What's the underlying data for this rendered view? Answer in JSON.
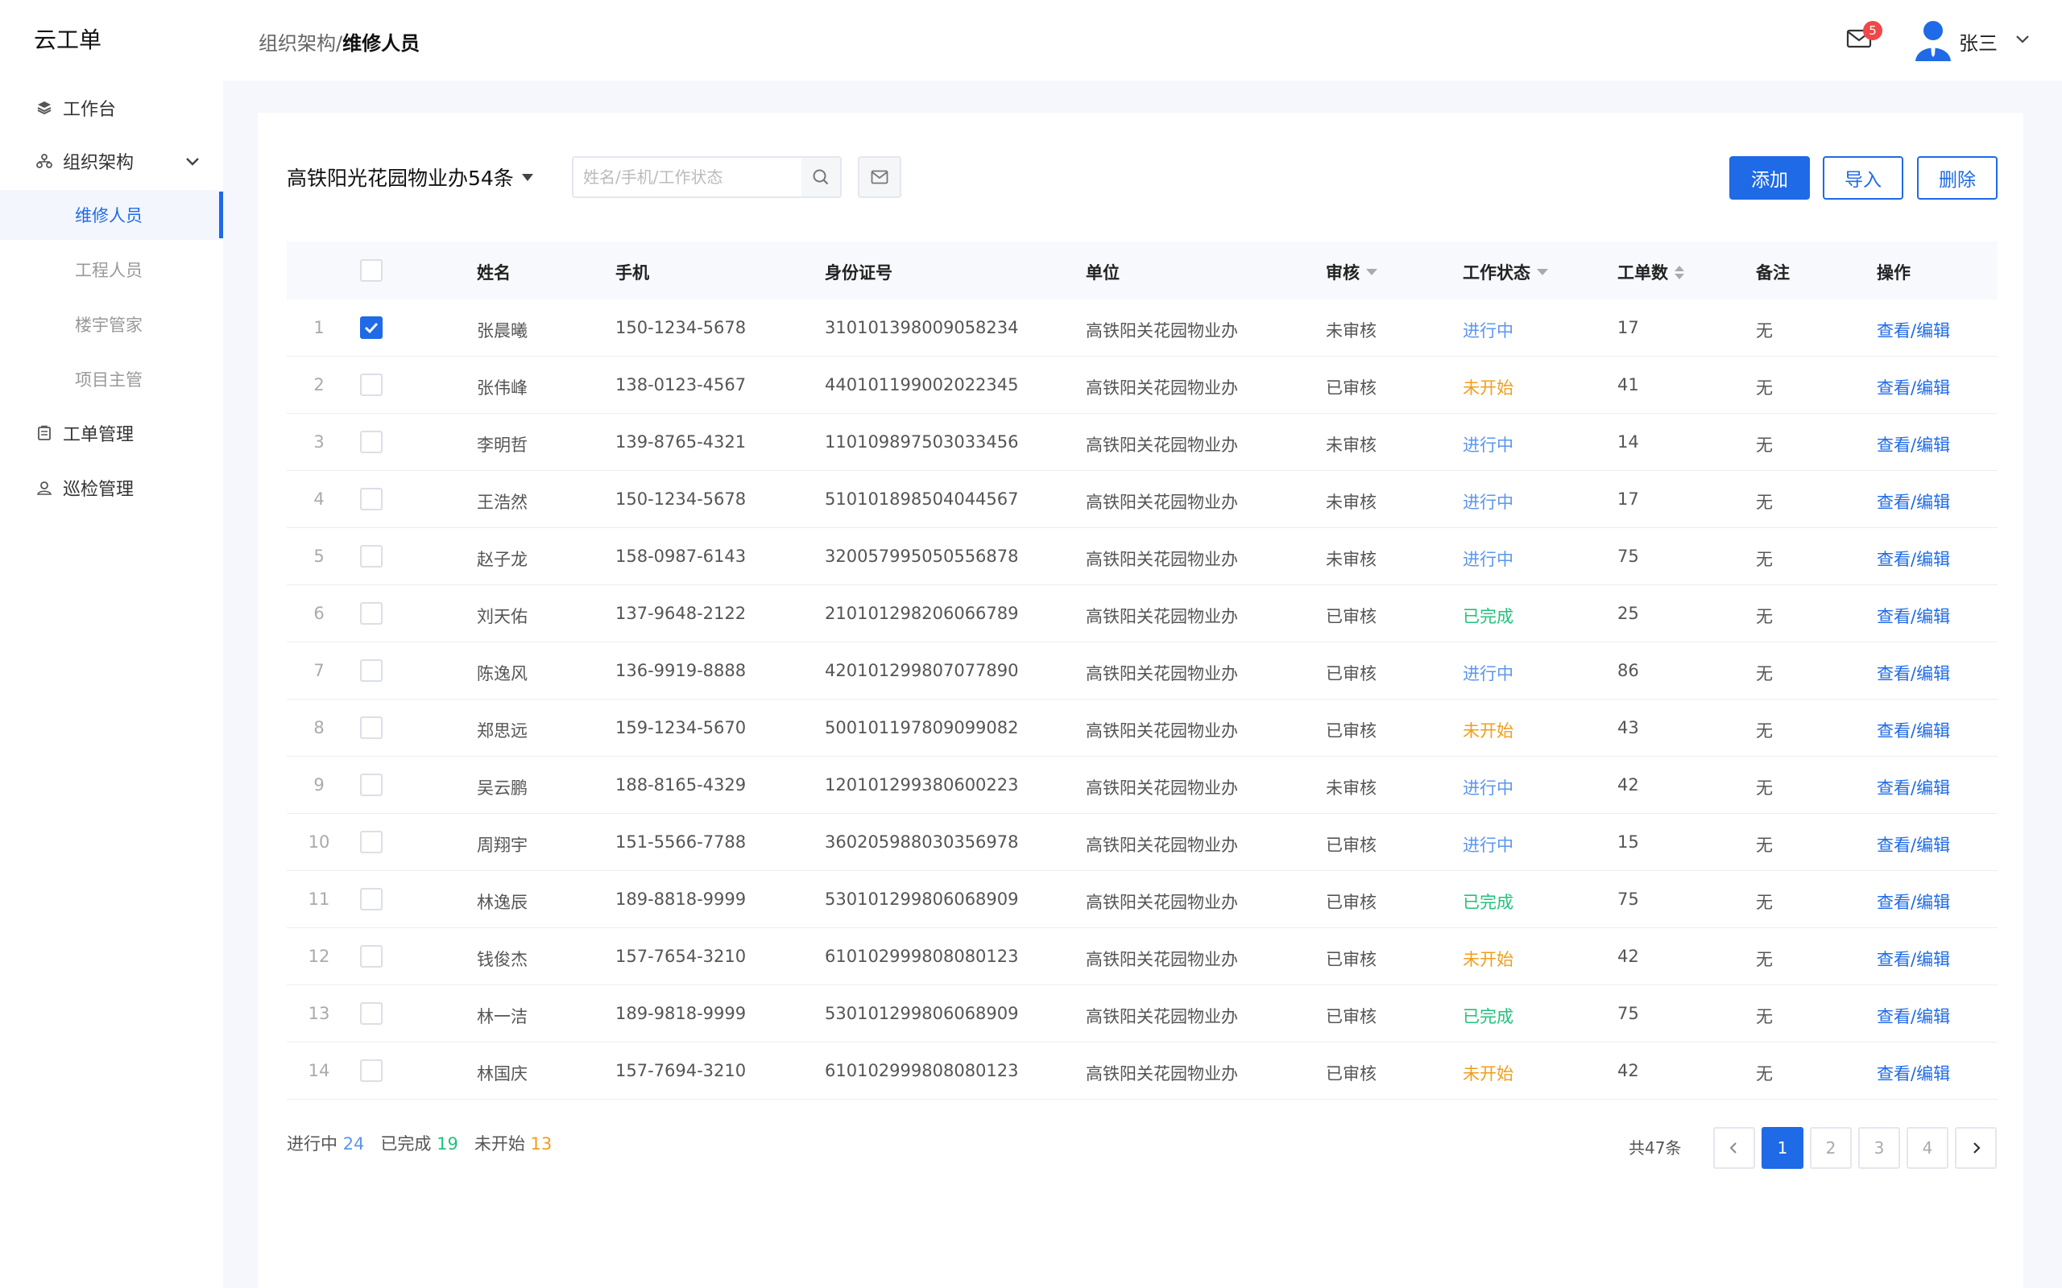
{
  "app": {
    "brand": "云工单"
  },
  "sidebar": {
    "workbench": "工作台",
    "org": "组织架构",
    "org_children": [
      "维修人员",
      "工程人员",
      "楼宇管家",
      "项目主管"
    ],
    "orders": "工单管理",
    "inspection": "巡检管理"
  },
  "header": {
    "breadcrumb_parent": "组织架构",
    "breadcrumb_sep": "/",
    "breadcrumb_current": "维修人员",
    "unread_count": "5",
    "username": "张三"
  },
  "toolbar": {
    "org_select": "高铁阳光花园物业办54条",
    "search_placeholder": "姓名/手机/工作状态",
    "add_label": "添加",
    "import_label": "导入",
    "delete_label": "删除"
  },
  "table": {
    "headers": [
      "姓名",
      "手机",
      "身份证号",
      "单位",
      "审核",
      "工作状态",
      "工单数",
      "备注",
      "操作"
    ],
    "rows": [
      {
        "idx": "1",
        "checked": true,
        "name": "张晨曦",
        "phone": "150-1234-5678",
        "id": "310101398009058234",
        "unit": "高铁阳关花园物业办",
        "audit": "未审核",
        "status": "进行中",
        "status_type": "ing",
        "orders": "17",
        "note": "无",
        "action": "查看/编辑"
      },
      {
        "idx": "2",
        "checked": false,
        "name": "张伟峰",
        "phone": "138-0123-4567",
        "id": "440101199002022345",
        "unit": "高铁阳关花园物业办",
        "audit": "已审核",
        "status": "未开始",
        "status_type": "none",
        "orders": "41",
        "note": "无",
        "action": "查看/编辑"
      },
      {
        "idx": "3",
        "checked": false,
        "name": "李明哲",
        "phone": "139-8765-4321",
        "id": "110109897503033456",
        "unit": "高铁阳关花园物业办",
        "audit": "未审核",
        "status": "进行中",
        "status_type": "ing",
        "orders": "14",
        "note": "无",
        "action": "查看/编辑"
      },
      {
        "idx": "4",
        "checked": false,
        "name": "王浩然",
        "phone": "150-1234-5678",
        "id": "510101898504044567",
        "unit": "高铁阳关花园物业办",
        "audit": "未审核",
        "status": "进行中",
        "status_type": "ing",
        "orders": "17",
        "note": "无",
        "action": "查看/编辑"
      },
      {
        "idx": "5",
        "checked": false,
        "name": "赵子龙",
        "phone": "158-0987-6143",
        "id": "320057995050556878",
        "unit": "高铁阳关花园物业办",
        "audit": "未审核",
        "status": "进行中",
        "status_type": "ing",
        "orders": "75",
        "note": "无",
        "action": "查看/编辑"
      },
      {
        "idx": "6",
        "checked": false,
        "name": "刘天佑",
        "phone": "137-9648-2122",
        "id": "210101298206066789",
        "unit": "高铁阳关花园物业办",
        "audit": "已审核",
        "status": "已完成",
        "status_type": "done",
        "orders": "25",
        "note": "无",
        "action": "查看/编辑"
      },
      {
        "idx": "7",
        "checked": false,
        "name": "陈逸风",
        "phone": "136-9919-8888",
        "id": "420101299807077890",
        "unit": "高铁阳关花园物业办",
        "audit": "已审核",
        "status": "进行中",
        "status_type": "ing",
        "orders": "86",
        "note": "无",
        "action": "查看/编辑"
      },
      {
        "idx": "8",
        "checked": false,
        "name": "郑思远",
        "phone": "159-1234-5670",
        "id": "500101197809099082",
        "unit": "高铁阳关花园物业办",
        "audit": "已审核",
        "status": "未开始",
        "status_type": "none",
        "orders": "43",
        "note": "无",
        "action": "查看/编辑"
      },
      {
        "idx": "9",
        "checked": false,
        "name": "吴云鹏",
        "phone": "188-8165-4329",
        "id": "120101299380600223",
        "unit": "高铁阳关花园物业办",
        "audit": "未审核",
        "status": "进行中",
        "status_type": "ing",
        "orders": "42",
        "note": "无",
        "action": "查看/编辑"
      },
      {
        "idx": "10",
        "checked": false,
        "name": "周翔宇",
        "phone": "151-5566-7788",
        "id": "360205988030356978",
        "unit": "高铁阳关花园物业办",
        "audit": "已审核",
        "status": "进行中",
        "status_type": "ing",
        "orders": "15",
        "note": "无",
        "action": "查看/编辑"
      },
      {
        "idx": "11",
        "checked": false,
        "name": "林逸辰",
        "phone": "189-8818-9999",
        "id": "530101299806068909",
        "unit": "高铁阳关花园物业办",
        "audit": "已审核",
        "status": "已完成",
        "status_type": "done",
        "orders": "75",
        "note": "无",
        "action": "查看/编辑"
      },
      {
        "idx": "12",
        "checked": false,
        "name": "钱俊杰",
        "phone": "157-7654-3210",
        "id": "610102999808080123",
        "unit": "高铁阳关花园物业办",
        "audit": "已审核",
        "status": "未开始",
        "status_type": "none",
        "orders": "42",
        "note": "无",
        "action": "查看/编辑"
      },
      {
        "idx": "13",
        "checked": false,
        "name": "林一洁",
        "phone": "189-9818-9999",
        "id": "530101299806068909",
        "unit": "高铁阳关花园物业办",
        "audit": "已审核",
        "status": "已完成",
        "status_type": "done",
        "orders": "75",
        "note": "无",
        "action": "查看/编辑"
      },
      {
        "idx": "14",
        "checked": false,
        "name": "林国庆",
        "phone": "157-7694-3210",
        "id": "610102999808080123",
        "unit": "高铁阳关花园物业办",
        "audit": "已审核",
        "status": "未开始",
        "status_type": "none",
        "orders": "42",
        "note": "无",
        "action": "查看/编辑"
      }
    ]
  },
  "summary": {
    "ing_label": "进行中",
    "ing_count": "24",
    "done_label": "已完成",
    "done_count": "19",
    "none_label": "未开始",
    "none_count": "13"
  },
  "pagination": {
    "total": "共47条",
    "pages": [
      "1",
      "2",
      "3",
      "4"
    ],
    "current": "1"
  },
  "colors": {
    "accent": "#1f6ae6",
    "status_ing": "#5b95ef",
    "status_none": "#f09e1a",
    "status_done": "#22c17e"
  }
}
